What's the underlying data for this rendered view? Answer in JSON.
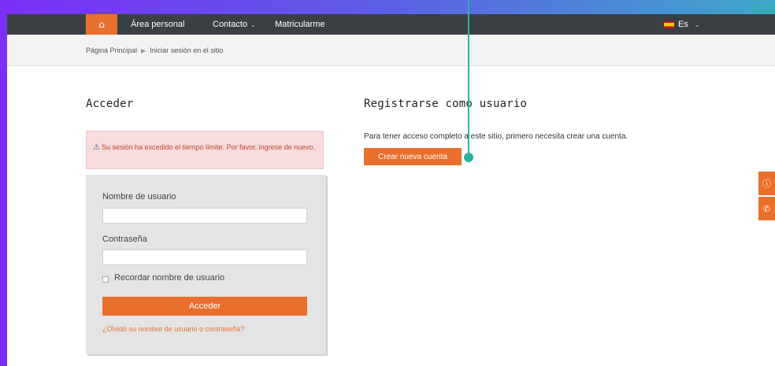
{
  "navbar": {
    "home_icon": "home-icon",
    "links": [
      {
        "label": "Área personal"
      },
      {
        "label": "Contacto",
        "has_dropdown": true
      },
      {
        "label": "Matricularme"
      }
    ],
    "language": {
      "label": "Es",
      "flag": "spain-flag-icon"
    }
  },
  "breadcrumb": {
    "items": [
      "Página Principal",
      "Iniciar sesión en el sitio"
    ],
    "separator": "▶"
  },
  "login": {
    "title": "Acceder",
    "alert": {
      "icon": "warning-icon",
      "text": "Su sesión ha excedido el tiempo límite. Por favor, ingrese de nuevo."
    },
    "username_label": "Nombre de usuario",
    "username_value": "",
    "password_label": "Contraseña",
    "password_value": "",
    "remember_label": "Recordar nombre de usuario",
    "remember_checked": false,
    "submit_label": "Acceder",
    "forgot_link": "¿Olvidó su nombre de usuario o contraseña?"
  },
  "register": {
    "title": "Registrarse como usuario",
    "description": "Para tener acceso completo a este sitio, primero necesita crear una cuenta.",
    "button_label": "Crear nueva cuenta"
  },
  "side_tabs": [
    "info-icon",
    "phone-icon"
  ],
  "colors": {
    "accent": "#e96f2d",
    "navbar": "#3a3f44",
    "frame": "#7b2ff7",
    "annotation": "#2bb3a0",
    "alert_bg": "#f6dcdc"
  }
}
